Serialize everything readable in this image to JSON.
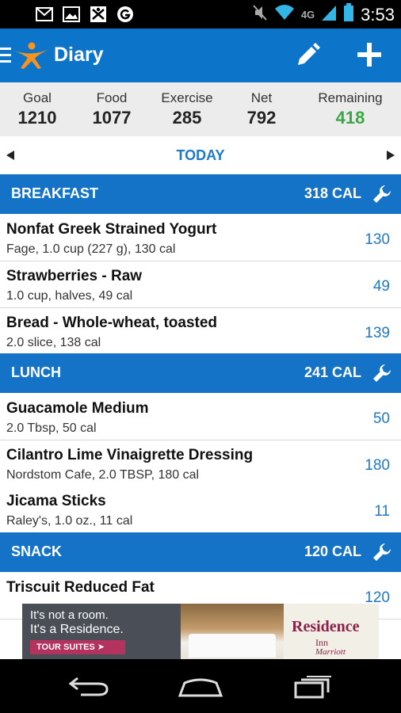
{
  "status_bar": {
    "network": "4G",
    "time": "3:53"
  },
  "app_bar": {
    "title": "Diary"
  },
  "summary": [
    {
      "label": "Goal",
      "value": "1210"
    },
    {
      "label": "Food",
      "value": "1077"
    },
    {
      "label": "Exercise",
      "value": "285"
    },
    {
      "label": "Net",
      "value": "792"
    },
    {
      "label": "Remaining",
      "value": "418"
    }
  ],
  "day_nav": {
    "label": "TODAY"
  },
  "meals": [
    {
      "name": "BREAKFAST",
      "calories": "318 CAL",
      "entries": [
        {
          "title": "Nonfat Greek Strained Yogurt",
          "detail": "Fage, 1.0 cup (227 g), 130 cal",
          "cal": "130"
        },
        {
          "title": "Strawberries - Raw",
          "detail": "1.0 cup, halves, 49 cal",
          "cal": "49"
        },
        {
          "title": "Bread - Whole-wheat, toasted",
          "detail": "2.0 slice, 138 cal",
          "cal": "139"
        }
      ]
    },
    {
      "name": "LUNCH",
      "calories": "241 CAL",
      "entries": [
        {
          "title": "Guacamole Medium",
          "detail": "2.0 Tbsp, 50 cal",
          "cal": "50"
        },
        {
          "title": "Cilantro Lime Vinaigrette Dressing",
          "detail": "Nordstom Cafe, 2.0 TBSP, 180 cal",
          "cal": "180"
        },
        {
          "title": "Jicama Sticks",
          "detail": "Raley's, 1.0 oz., 11 cal",
          "cal": "11"
        }
      ]
    },
    {
      "name": "SNACK",
      "calories": "120 CAL",
      "entries": [
        {
          "title": "Triscuit Reduced Fat",
          "detail": "",
          "cal": "120"
        }
      ]
    }
  ],
  "ad": {
    "line1": "It's not a room.",
    "line2": "It's a Residence.",
    "button": "TOUR SUITES ➤",
    "brand": "Residence",
    "brand_sub": "Inn",
    "brand_sub2": "Marriott"
  },
  "colors": {
    "primary": "#0d75c9",
    "section": "#1473c6",
    "accent_text": "#1e7ac6",
    "remaining": "#3aa845"
  }
}
